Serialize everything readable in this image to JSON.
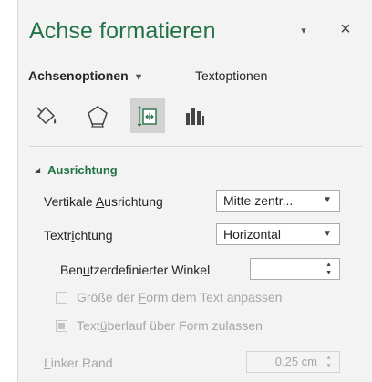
{
  "pane": {
    "title": "Achse formatieren",
    "dropdown_glyph": "▾",
    "close_glyph": "×"
  },
  "tabs": {
    "axis_options": "Achsenoptionen",
    "axis_caret": "▼",
    "text_options": "Textoptionen"
  },
  "icons": [
    "fill-line-icon",
    "effects-pentagon-icon",
    "size-properties-icon",
    "axis-options-bars-icon"
  ],
  "selected_icon": "size-properties-icon",
  "colors": {
    "accent": "#217346",
    "pane_bg": "#f3f3f3",
    "selected_bg": "#d2d2d2"
  },
  "section": {
    "title": "Ausrichtung",
    "vertical_alignment": {
      "label_pre": "Vertikale ",
      "label_key": "A",
      "label_post": "usrichtung",
      "value": "Mitte zentr..."
    },
    "text_direction": {
      "label_pre": "Textr",
      "label_key": "i",
      "label_post": "chtung",
      "value": "Horizontal"
    },
    "custom_angle": {
      "label_pre": "Ben",
      "label_key": "u",
      "label_post": "tzerdefinierter Winkel",
      "value": ""
    },
    "resize_shape": {
      "label_pre": "Größe der ",
      "label_key": "F",
      "label_post": "orm dem Text anpassen",
      "checked": false
    },
    "overflow": {
      "label_pre": "Text",
      "label_key": "ü",
      "label_post": "berlauf über Form zulassen",
      "state": "indeterminate"
    },
    "left_margin": {
      "label_key": "L",
      "label_post": "inker Rand",
      "value": "0,25 cm"
    }
  }
}
